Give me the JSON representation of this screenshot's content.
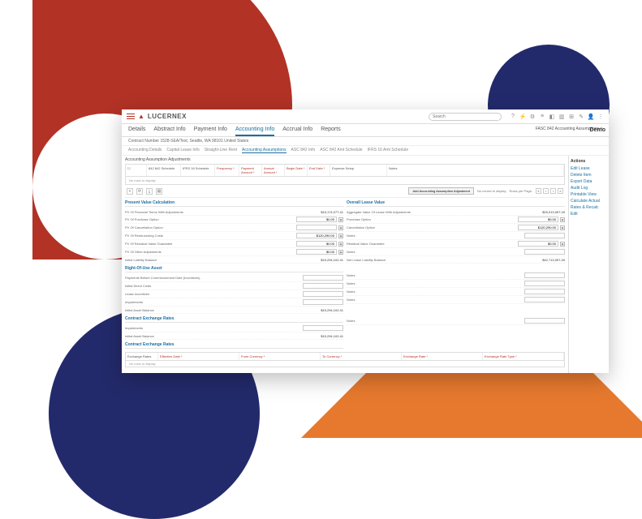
{
  "brand": "LUCERNEX",
  "search_placeholder": "Search",
  "top_icons": [
    "?",
    "⚡",
    "⚙",
    "≡",
    "◧",
    "▥",
    "⊞",
    "✎",
    "👤",
    "⋮"
  ],
  "primary_tabs": [
    "Details",
    "Abstract Info",
    "Payment Info",
    "Accounting Info",
    "Accrual Info",
    "Reports"
  ],
  "breadcrumb": "Contract Number 1528-SEA/Test, Seattle, WA 98101 United States",
  "header_right": "FASC 842 Accounting Assumptions ▾",
  "secondary_tabs": [
    "Accounting Details",
    "Capital Lease Info",
    "Straight-Line Rent",
    "Accounting Assumptions",
    "ASC 842 Info",
    "ASC 842 Amt Schedule",
    "IFRS 16 Amt Schedule"
  ],
  "adjustments_title": "Accounting Assumption Adjustments",
  "grid_cols": [
    "☐",
    "842 842 Schedule",
    "IFRS 16 Schedule",
    "Frequency *",
    "Payment Amount *",
    "Annual Amount *",
    "Begin Date *",
    "End Date *",
    "Expense Setup",
    "Notes"
  ],
  "grid_empty": "No rows to display",
  "toolbar_btn": "Add Accounting Assumption Adjustment",
  "toolbar_status": "No record to display",
  "toolbar_hint": "Rows per Page:",
  "demo_label": "Demo",
  "sections": {
    "pv_title": "Present Value Calculation",
    "pv_rows": [
      {
        "label": "PV Of Financial Terms With Adjustments",
        "value": "$15,174,077.41"
      },
      {
        "label": "PV Of Purchase Option",
        "input": "$0.00",
        "icon": true
      },
      {
        "label": "PV Of Cancellation Option",
        "input": "",
        "icon": true
      },
      {
        "label": "PV Of Restructuring Costs",
        "input": "$120,290.00",
        "icon": true
      },
      {
        "label": "PV Of Residual Value Guarantee",
        "input": "$0.00",
        "icon": true
      },
      {
        "label": "PV Of Other Adjustments",
        "input": "$0.00",
        "icon": true
      },
      {
        "label": "Initial Liability Balance",
        "value": "$15,294,102.41"
      }
    ],
    "rou_title": "Right-Of-Use Asset",
    "rou_rows": [
      {
        "label": "Payments Before Commencement Date (Incentives)",
        "input": ""
      },
      {
        "label": "Initial Direct Costs",
        "input": ""
      },
      {
        "label": "Lease Incentives",
        "input": ""
      },
      {
        "label": "Impairments",
        "input": ""
      },
      {
        "label": "Initial Asset Balance",
        "value": "$15,294,102.41"
      }
    ],
    "cer1_title": "Contract Exchange Rates",
    "cer1_rows": [
      {
        "label": "Impairments",
        "input": ""
      },
      {
        "label": "Initial Asset Balance",
        "value": "$15,294,102.41"
      }
    ],
    "cer2_title": "Contract Exchange Rates",
    "olv_title": "Overall Lease Value",
    "olv_rows": [
      {
        "label": "Aggregate Value Of Lease With Adjustments",
        "value": "$25,013,997.49"
      },
      {
        "label": "Purchase Option",
        "input": "$0.00",
        "icon": true
      },
      {
        "label": "Cancellation Option",
        "input": "$120,290.00",
        "icon": true
      },
      {
        "label": "Notes",
        "input": ""
      },
      {
        "label": "Residual Value Guarantee",
        "input": "$0.00",
        "icon": true
      },
      {
        "label": "Notes",
        "input": ""
      },
      {
        "label": "Net Lease Liability Balance",
        "value": "$42,713,997.49"
      }
    ],
    "rnotes": [
      {
        "label": "Notes",
        "input": ""
      },
      {
        "label": "Notes",
        "input": ""
      },
      {
        "label": "Notes",
        "input": ""
      },
      {
        "label": "Notes",
        "input": ""
      }
    ],
    "rnote_single": {
      "label": "Notes",
      "input": ""
    }
  },
  "rates_cols": [
    "Exchange Rates",
    "Effective Date *",
    "From Currency *",
    "To Currency *",
    "Exchange Rate *",
    "Exchange Rate Type *"
  ],
  "rates_empty": "No rows to display",
  "sidebar": {
    "header": "Actions",
    "items": [
      "Edit Lease",
      "Delete Item",
      "Export Data",
      "Audit Log",
      "Printable View",
      "Calculate Actual",
      "Rates & Recalc",
      "Edit"
    ]
  }
}
